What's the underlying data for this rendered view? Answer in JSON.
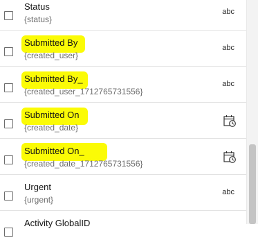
{
  "fields": [
    {
      "label": "Status",
      "expression": "{status}",
      "type_label": "abc",
      "type_icon": "text-type-icon",
      "highlighted": false
    },
    {
      "label": "Submitted By",
      "expression": "{created_user}",
      "type_label": "abc",
      "type_icon": "text-type-icon",
      "highlighted": true
    },
    {
      "label": "Submitted By_",
      "expression": "{created_user_1712765731556}",
      "type_label": "abc",
      "type_icon": "text-type-icon",
      "highlighted": true
    },
    {
      "label": "Submitted On",
      "expression": "{created_date}",
      "type_label": "",
      "type_icon": "date-time-icon",
      "highlighted": true
    },
    {
      "label": "Submitted On_",
      "expression": "{created_date_1712765731556}",
      "type_label": "",
      "type_icon": "date-time-icon",
      "highlighted": true
    },
    {
      "label": "Urgent",
      "expression": "{urgent}",
      "type_label": "abc",
      "type_icon": "text-type-icon",
      "highlighted": false
    },
    {
      "label": "Activity GlobalID",
      "expression": "",
      "type_label": "",
      "type_icon": "",
      "highlighted": false
    }
  ],
  "colors": {
    "highlight": "#fbfb06"
  }
}
